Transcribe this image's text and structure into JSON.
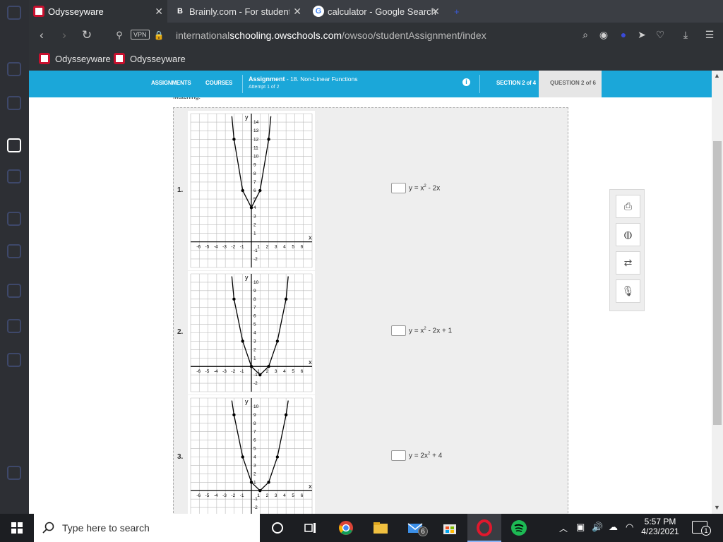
{
  "browser": {
    "tabs": [
      {
        "title": "Odysseyware",
        "active": true
      },
      {
        "title": "Brainly.com - For students.",
        "active": false
      },
      {
        "title": "calculator - Google Search",
        "active": false
      }
    ],
    "vpn_label": "VPN",
    "url_prefix": "international",
    "url_domain": "schooling.owschools.com",
    "url_path": "/owsoo/studentAssignment/index",
    "bookmarks": [
      "Odysseyware",
      "Odysseyware"
    ]
  },
  "app_nav": {
    "assignments": "ASSIGNMENTS",
    "courses": "COURSES",
    "assignment_label": "Assignment",
    "assignment_name": " - 18. Non-Linear Functions",
    "attempt": "Attempt 1 of 2",
    "info_icon": "i",
    "section": "SECTION 2 of 4",
    "question": "QUESTION 2 of 6"
  },
  "instructions": "Matching:",
  "problems": [
    {
      "number": "1.",
      "eq_base": "y = x",
      "eq_exp": "2",
      "eq_rest": " - 2x"
    },
    {
      "number": "2.",
      "eq_base": "y = x",
      "eq_exp": "2",
      "eq_rest": " - 2x + 1"
    },
    {
      "number": "3.",
      "eq_base": "y = 2x",
      "eq_exp": "2",
      "eq_rest": " + 4"
    }
  ],
  "graphs": [
    {
      "points": [
        [
          -2,
          12
        ],
        [
          -1,
          6
        ],
        [
          0,
          4
        ],
        [
          1,
          6
        ],
        [
          2,
          12
        ]
      ],
      "ymin": -2,
      "ymax": 14,
      "yticks": [
        14,
        13,
        12,
        11,
        10,
        9,
        8,
        7,
        6,
        5,
        4,
        3,
        2,
        1,
        -1,
        -2
      ]
    },
    {
      "points": [
        [
          -2,
          8
        ],
        [
          -1,
          3
        ],
        [
          0,
          0
        ],
        [
          1,
          -1
        ],
        [
          2,
          0
        ],
        [
          3,
          3
        ],
        [
          4,
          8
        ]
      ],
      "ymin": -2,
      "ymax": 10,
      "yticks": [
        10,
        9,
        8,
        7,
        6,
        5,
        4,
        3,
        2,
        1,
        -1,
        -2
      ]
    },
    {
      "points": [
        [
          -2,
          9
        ],
        [
          -1,
          4
        ],
        [
          0,
          1
        ],
        [
          1,
          0
        ],
        [
          2,
          1
        ],
        [
          3,
          4
        ],
        [
          4,
          9
        ]
      ],
      "ymin": -2,
      "ymax": 10,
      "yticks": [
        10,
        9,
        8,
        7,
        6,
        5,
        4,
        3,
        2,
        1,
        -1,
        -2
      ]
    }
  ],
  "axis_labels": {
    "x": "x",
    "y": "y"
  },
  "xticks": [
    -6,
    -5,
    -4,
    -3,
    -2,
    -1,
    1,
    2,
    3,
    4,
    5,
    6
  ],
  "taskbar": {
    "search_placeholder": "Type here to search",
    "mail_badge": "6",
    "time": "5:57 PM",
    "date": "4/23/2021",
    "notification_count": "1"
  },
  "colors": {
    "accent": "#1ba7d9",
    "brand_red": "#c8102e"
  }
}
